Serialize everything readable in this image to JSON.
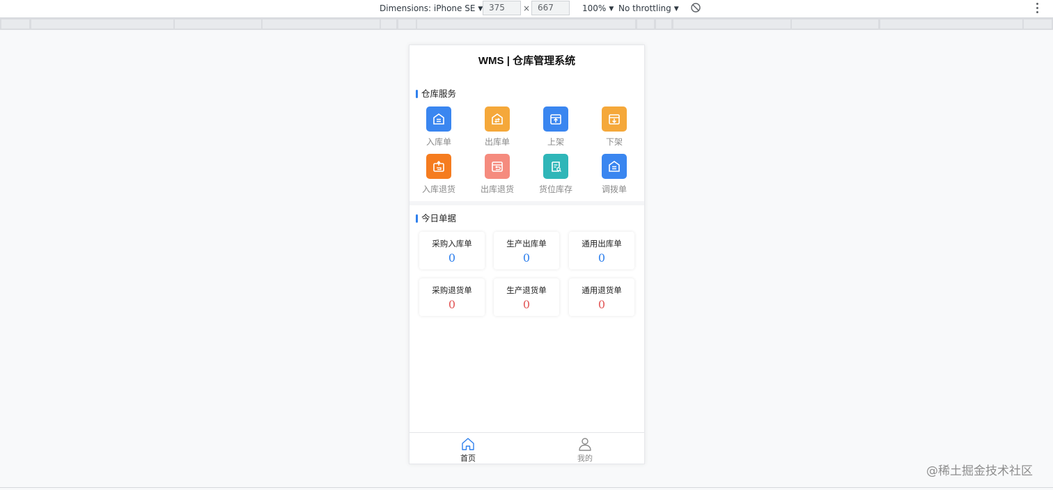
{
  "devtools": {
    "dimensions_label": "Dimensions: iPhone SE",
    "width_value": "375",
    "times": "×",
    "height_value": "667",
    "zoom": "100%",
    "throttling": "No throttling"
  },
  "app": {
    "title": "WMS | 仓库管理系统",
    "services_title": "仓库服务",
    "services": [
      {
        "label": "入库单",
        "color": "#3a86f0"
      },
      {
        "label": "出库单",
        "color": "#f5a83a"
      },
      {
        "label": "上架",
        "color": "#3a86f0"
      },
      {
        "label": "下架",
        "color": "#f5a83a"
      },
      {
        "label": "入库退货",
        "color": "#f57c1f"
      },
      {
        "label": "出库退货",
        "color": "#f58b7e"
      },
      {
        "label": "货位库存",
        "color": "#2fb6b8"
      },
      {
        "label": "调拨单",
        "color": "#3a86f0"
      }
    ],
    "today_title": "今日单据",
    "today": [
      {
        "label": "采购入库单",
        "value": "0",
        "color": "#2f80ed"
      },
      {
        "label": "生产出库单",
        "value": "0",
        "color": "#2f80ed"
      },
      {
        "label": "通用出库单",
        "value": "0",
        "color": "#2f80ed"
      },
      {
        "label": "采购退货单",
        "value": "0",
        "color": "#e25555"
      },
      {
        "label": "生产退货单",
        "value": "0",
        "color": "#e25555"
      },
      {
        "label": "通用退货单",
        "value": "0",
        "color": "#e25555"
      }
    ],
    "tabs": [
      {
        "label": "首页",
        "icon": "home-icon",
        "active": true
      },
      {
        "label": "我的",
        "icon": "user-icon",
        "active": false
      }
    ]
  },
  "watermark": "@稀土掘金技术社区",
  "colors": {
    "accent": "#2f80ed",
    "active_tab": "#2f80ed",
    "inactive_tab": "#8a8a8a"
  }
}
